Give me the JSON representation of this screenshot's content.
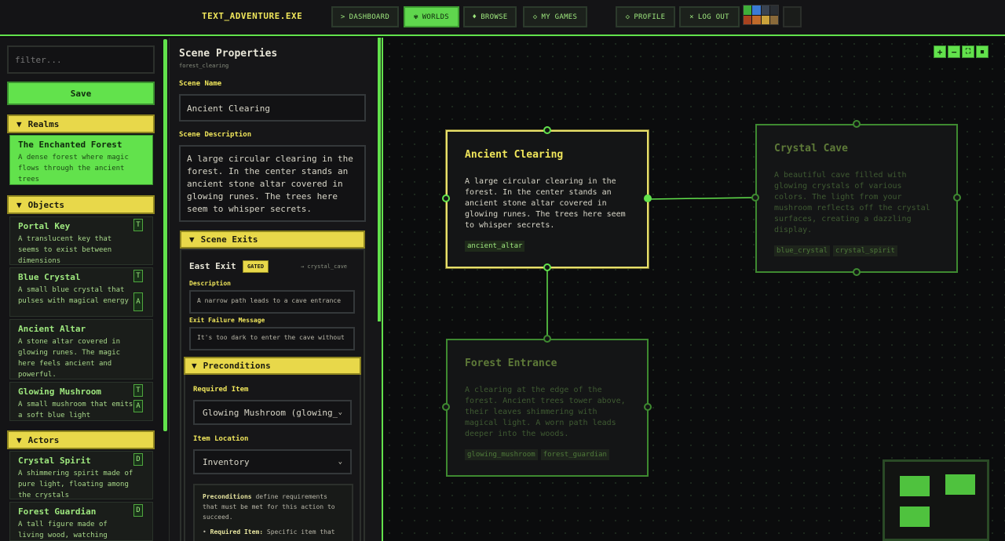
{
  "app": {
    "title": "TEXT_ADVENTURE.EXE"
  },
  "nav": {
    "dashboard": {
      "glyph": ">",
      "label": "DASHBOARD"
    },
    "worlds": {
      "glyph": "✾",
      "label": "WORLDS"
    },
    "browse": {
      "glyph": "♦",
      "label": "BROWSE"
    },
    "my_games": {
      "glyph": "◇",
      "label": "MY GAMES"
    },
    "profile": {
      "glyph": "◇",
      "label": "PROFILE"
    },
    "logout": {
      "glyph": "×",
      "label": "LOG OUT"
    }
  },
  "theme_swatches": [
    "#3fae3a",
    "#3a7bd5",
    "#3a4452",
    "#2a2e33",
    "#a8421f",
    "#c06a2a",
    "#caa23a",
    "#8a6a3a"
  ],
  "colors": {
    "accent": "#62e24c",
    "highlight": "#e8d84a"
  },
  "sidebar": {
    "filter_placeholder": "filter...",
    "save_label": "Save",
    "realms": {
      "header": "Realms",
      "items": [
        {
          "name": "The Enchanted Forest",
          "desc": "A dense forest where magic flows through the ancient trees"
        }
      ]
    },
    "objects": {
      "header": "Objects",
      "items": [
        {
          "name": "Portal Key",
          "desc": "A translucent key that seems to exist between dimensions",
          "badges": [
            "T"
          ]
        },
        {
          "name": "Blue Crystal",
          "desc": "A small blue crystal that pulses with magical energy",
          "badges": [
            "T",
            "A"
          ]
        },
        {
          "name": "Ancient Altar",
          "desc": "A stone altar covered in glowing runes. The magic here feels ancient and powerful.",
          "badges": []
        },
        {
          "name": "Glowing Mushroom",
          "desc": "A small mushroom that emits a soft blue light",
          "badges": [
            "T",
            "A"
          ]
        }
      ]
    },
    "actors": {
      "header": "Actors",
      "items": [
        {
          "name": "Crystal Spirit",
          "desc": "A shimmering spirit made of pure light, floating among the crystals",
          "badges": [
            "D"
          ]
        },
        {
          "name": "Forest Guardian",
          "desc": "A tall figure made of living wood, watching",
          "badges": [
            "D"
          ]
        }
      ]
    }
  },
  "props": {
    "title": "Scene Properties",
    "scene_id": "forest_clearing",
    "name_label": "Scene Name",
    "name_value": "Ancient Clearing",
    "desc_label": "Scene Description",
    "desc_value": "A large circular clearing in the forest. In the center stands an ancient stone altar covered in glowing runes. The trees here seem to whisper secrets.",
    "exits_header": "Scene Exits",
    "exit": {
      "title": "East Exit",
      "gated": "GATED",
      "target": "→ crystal_cave",
      "desc_label": "Description",
      "desc_value": "A narrow path leads to a cave entrance",
      "fail_label": "Exit Failure Message",
      "fail_value": "It's too dark to enter the cave without"
    },
    "preconditions": {
      "header": "Preconditions",
      "required_item_label": "Required Item",
      "required_item_value": "Glowing Mushroom (glowing_",
      "item_location_label": "Item Location",
      "item_location_value": "Inventory",
      "info_bold": "Preconditions",
      "info_text": " define requirements that must be met for this action to succeed.",
      "bullet_bold": "Required Item:",
      "bullet_text": " Specific item that"
    }
  },
  "canvas": {
    "controls": [
      "+",
      "−",
      "⛶",
      "🔒"
    ],
    "nodes": [
      {
        "title": "Ancient Clearing",
        "desc": "A large circular clearing in the forest. In the center stands an ancient stone altar covered in glowing runes. The trees here seem to whisper secrets.",
        "tags": [
          "ancient_altar"
        ]
      },
      {
        "title": "Crystal Cave",
        "desc": "A beautiful cave filled with glowing crystals of various colors. The light from your mushroom reflects off the crystal surfaces, creating a dazzling display.",
        "tags": [
          "blue_crystal",
          "crystal_spirit"
        ]
      },
      {
        "title": "Forest Entrance",
        "desc": "A clearing at the edge of the forest. Ancient trees tower above, their leaves shimmering with magical light. A worn path leads deeper into the woods.",
        "tags": [
          "glowing_mushroom",
          "forest_guardian"
        ]
      }
    ]
  }
}
